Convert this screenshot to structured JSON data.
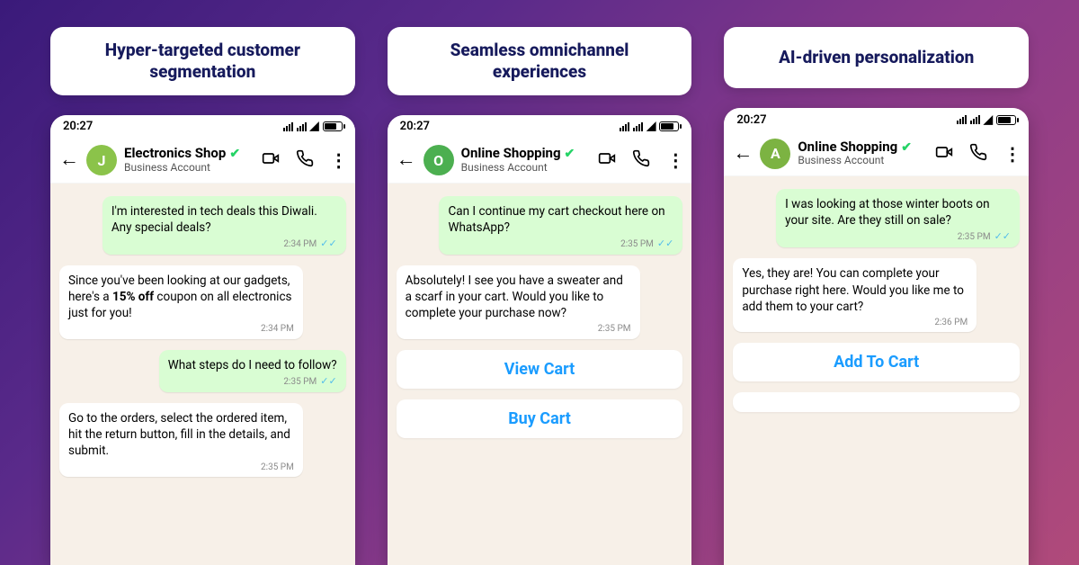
{
  "columns": [
    {
      "title": "Hyper-targeted customer segmentation",
      "time": "20:27",
      "avatar_letter": "J",
      "chat_name": "Electronics Shop",
      "chat_sub": "Business Account",
      "msg1": "I'm interested in tech deals this Diwali. Any special deals?",
      "msg1_ts": "2:34 PM",
      "msg2_pre": "Since you've been looking at our gadgets, here's a ",
      "msg2_bold": "15% off",
      "msg2_post": " coupon on all electronics just for you!",
      "msg2_ts": "2:34 PM",
      "msg3": "What steps do I need to follow?",
      "msg3_ts": "2:35 PM",
      "msg4": "Go to the orders, select the ordered item, hit the return button, fill in the details, and submit.",
      "msg4_ts": "2:35 PM"
    },
    {
      "title": "Seamless omnichannel experiences",
      "time": "20:27",
      "avatar_letter": "O",
      "chat_name": "Online Shopping",
      "chat_sub": "Business Account",
      "msg1": "Can I continue my cart checkout here on WhatsApp?",
      "msg1_ts": "2:35 PM",
      "msg2": "Absolutely! I see you have a sweater and a scarf in your cart. Would you like to complete your purchase now?",
      "msg2_ts": "2:35 PM",
      "btn1": "View Cart",
      "btn2": "Buy Cart"
    },
    {
      "title": "AI-driven personalization",
      "time": "20:27",
      "avatar_letter": "A",
      "chat_name": "Online Shopping",
      "chat_sub": "Business Account",
      "msg1": "I was looking at those winter boots on your site. Are they still on sale?",
      "msg1_ts": "2:35 PM",
      "msg2": "Yes, they are! You can complete your purchase right here. Would you like me to add them to your cart?",
      "msg2_ts": "2:36 PM",
      "btn1": "Add To Cart",
      "btn2": ""
    }
  ]
}
